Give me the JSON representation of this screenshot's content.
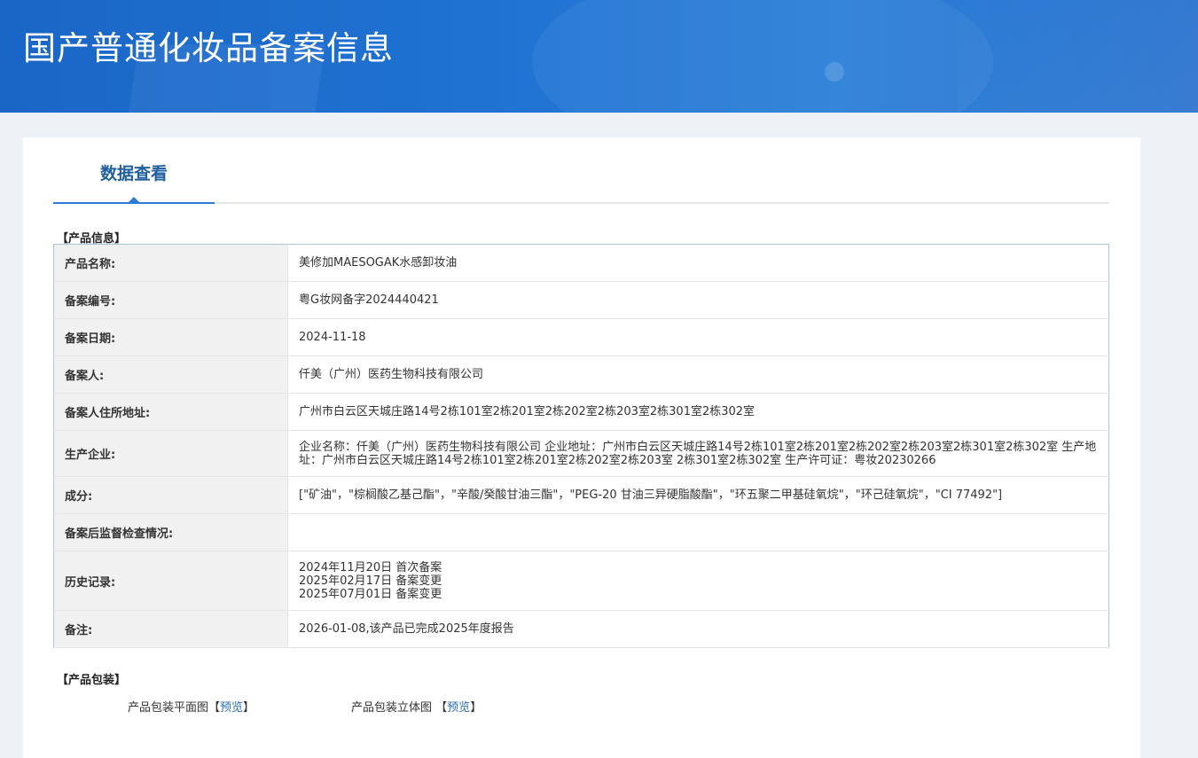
{
  "banner": {
    "title": "国产普通化妆品备案信息"
  },
  "tabs": [
    {
      "label": "数据查看",
      "active": true
    }
  ],
  "sections": {
    "product_info": "【产品信息】",
    "product_package": "【产品包装】"
  },
  "product_info": [
    {
      "key": "产品名称:",
      "value": "美修加MAESOGAK水感卸妆油"
    },
    {
      "key": "备案编号:",
      "value": "粤G妆网备字2024440421"
    },
    {
      "key": "备案日期:",
      "value": "2024-11-18"
    },
    {
      "key": "备案人:",
      "value": "仟美（广州）医药生物科技有限公司"
    },
    {
      "key": "备案人住所地址:",
      "value": "广州市白云区天城庄路14号2栋101室2栋201室2栋202室2栋203室2栋301室2栋302室"
    },
    {
      "key": "生产企业:",
      "value": "企业名称：仟美（广州）医药生物科技有限公司 企业地址：广州市白云区天城庄路14号2栋101室2栋201室2栋202室2栋203室2栋301室2栋302室 生产地址：广州市白云区天城庄路14号2栋101室2栋201室2栋202室2栋203室 2栋301室2栋302室 生产许可证：粤妆20230266"
    },
    {
      "key": "成分:",
      "value": "[\"矿油\"，\"棕榈酸乙基己酯\"，\"辛酸/癸酸甘油三酯\"，\"PEG-20 甘油三异硬脂酸酯\"，\"环五聚二甲基硅氧烷\"，\"环己硅氧烷\"，\"CI 77492\"]"
    },
    {
      "key": "备案后监督检查情况:",
      "value": ""
    },
    {
      "key": "历史记录:",
      "lines": [
        "2024年11月20日 首次备案",
        "2025年02月17日 备案变更",
        "2025年07月01日 备案变更"
      ]
    },
    {
      "key": "备注:",
      "value": "2026-01-08,该产品已完成2025年度报告"
    }
  ],
  "package": {
    "flat_label": "产品包装平面图",
    "solid_label": "产品包装立体图",
    "bracket_open": "【",
    "bracket_close": "】",
    "preview_link": "预览"
  }
}
